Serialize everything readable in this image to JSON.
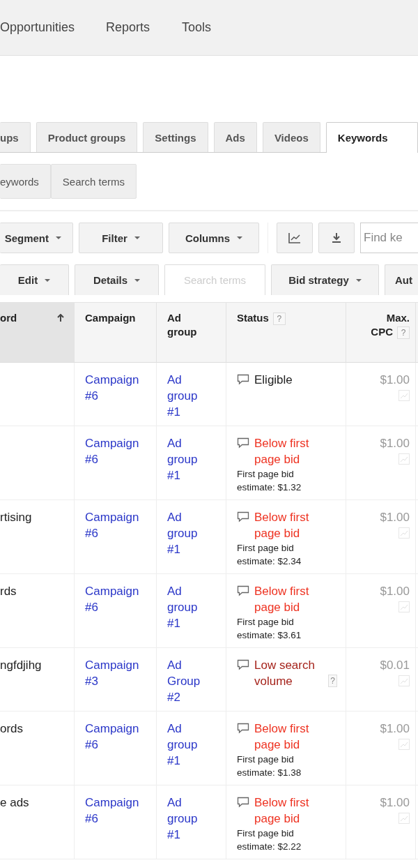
{
  "top_nav": [
    {
      "label": "Opportunities"
    },
    {
      "label": "Reports"
    },
    {
      "label": "Tools"
    }
  ],
  "tabs": [
    {
      "label": "ups",
      "selected": false
    },
    {
      "label": "Product groups",
      "selected": false
    },
    {
      "label": "Settings",
      "selected": false
    },
    {
      "label": "Ads",
      "selected": false
    },
    {
      "label": "Videos",
      "selected": false
    },
    {
      "label": "Keywords",
      "selected": true
    }
  ],
  "subtabs": [
    {
      "label": "eywords"
    },
    {
      "label": "Search terms"
    }
  ],
  "toolbar": {
    "buttons": [
      {
        "label": "Segment"
      },
      {
        "label": "Filter"
      },
      {
        "label": "Columns"
      }
    ],
    "find_field": {
      "placeholder": "Find ke"
    }
  },
  "actions": [
    {
      "label": "Edit",
      "dropdown": true,
      "disabled": false
    },
    {
      "label": "Details",
      "dropdown": true,
      "disabled": false
    },
    {
      "label": "Search terms",
      "dropdown": false,
      "disabled": true
    },
    {
      "label": "Bid strategy",
      "dropdown": true,
      "disabled": false
    },
    {
      "label": "Aut",
      "dropdown": false,
      "disabled": false
    }
  ],
  "table": {
    "columns": [
      {
        "label": "ord",
        "sorted": true
      },
      {
        "label": "Campaign",
        "sorted": false
      },
      {
        "label": "Ad group",
        "sorted": false
      },
      {
        "label": "Status",
        "sorted": false,
        "help": "?"
      },
      {
        "label": "Max. CPC",
        "sorted": false,
        "help": "?"
      }
    ],
    "rows": [
      {
        "campaign": "Campaign #6",
        "ad_group": "Ad group #1",
        "status": {
          "kind": "eligible",
          "text": "Eligible"
        },
        "max_cpc": "$1.00"
      },
      {
        "campaign": "Campaign #6",
        "ad_group": "Ad group #1",
        "status": {
          "kind": "below",
          "text": "Below first page bid",
          "detail": "First page bid estimate: $1.32"
        },
        "max_cpc": "$1.00"
      },
      {
        "keyword": "rtising",
        "campaign": "Campaign #6",
        "ad_group": "Ad group #1",
        "status": {
          "kind": "below",
          "text": "Below first page bid",
          "detail": "First page bid estimate: $2.34"
        },
        "max_cpc": "$1.00"
      },
      {
        "keyword": "rds",
        "campaign": "Campaign #6",
        "ad_group": "Ad group #1",
        "status": {
          "kind": "below",
          "text": "Below first page bid",
          "detail": "First page bid estimate: $3.61"
        },
        "max_cpc": "$1.00"
      },
      {
        "keyword": "ngfdjihg",
        "campaign": "Campaign #3",
        "ad_group": "Ad Group #2",
        "status": {
          "kind": "low",
          "text": "Low search volume",
          "help": "?"
        },
        "max_cpc": "$0.01"
      },
      {
        "keyword": "ords",
        "campaign": "Campaign #6",
        "ad_group": "Ad group #1",
        "status": {
          "kind": "below",
          "text": "Below first page bid",
          "detail": "First page bid estimate: $1.38"
        },
        "max_cpc": "$1.00"
      },
      {
        "keyword": "e ads",
        "campaign": "Campaign #6",
        "ad_group": "Ad group #1",
        "status": {
          "kind": "below",
          "text": "Below first page bid",
          "detail": "First page bid estimate: $2.22"
        },
        "max_cpc": "$1.00"
      }
    ]
  }
}
